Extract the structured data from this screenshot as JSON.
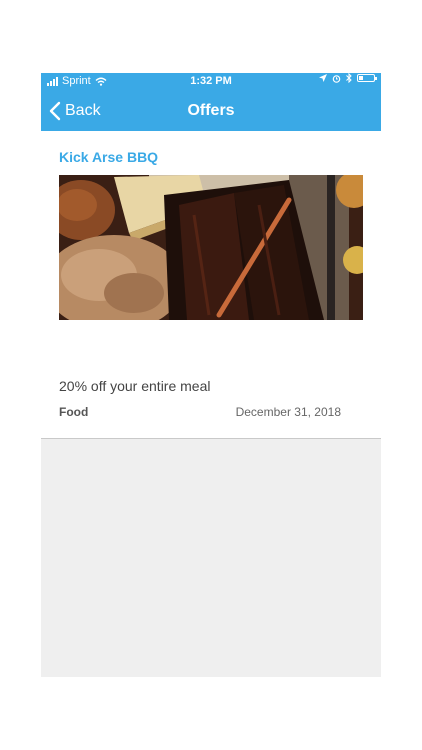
{
  "status_bar": {
    "carrier": "Sprint",
    "time": "1:32 PM"
  },
  "nav": {
    "back_label": "Back",
    "title": "Offers"
  },
  "offer": {
    "business_name": "Kick Arse BBQ",
    "image_alt": "BBQ ribs, pulled pork and bread",
    "description": "20% off your entire meal",
    "category": "Food",
    "expires": "December 31, 2018"
  },
  "colors": {
    "brand": "#3aa9e6",
    "background": "#efefef"
  }
}
